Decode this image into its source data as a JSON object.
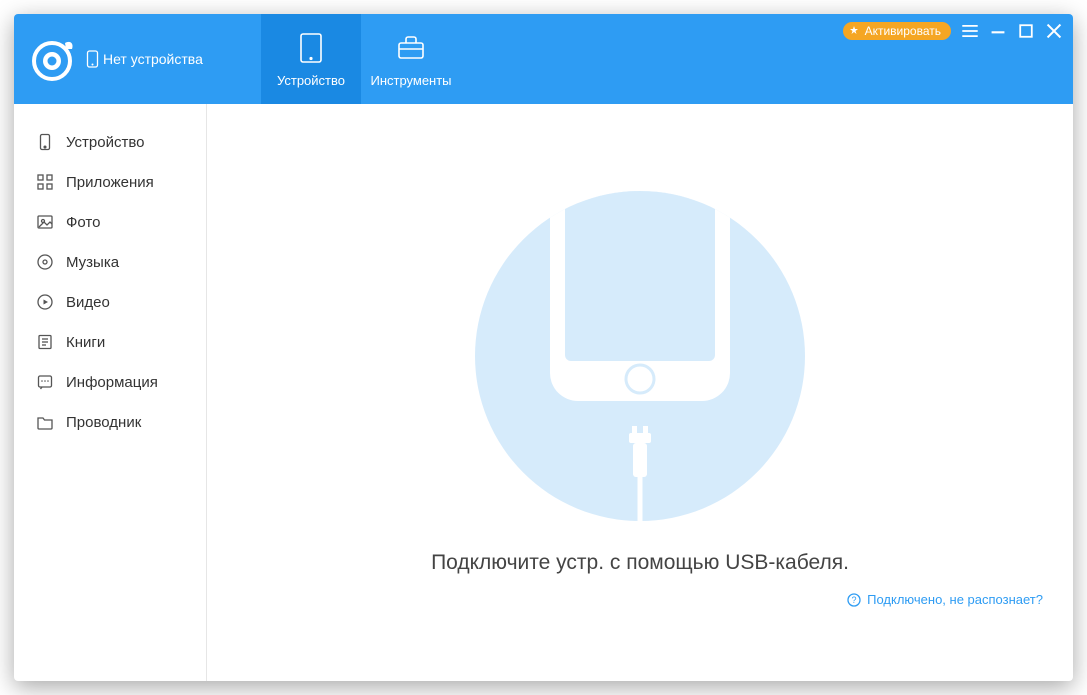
{
  "header": {
    "device_status": "Нет устройства",
    "tabs": {
      "device": "Устройство",
      "tools": "Инструменты"
    },
    "activate": "Активировать"
  },
  "sidebar": {
    "device": "Устройство",
    "apps": "Приложения",
    "photos": "Фото",
    "music": "Музыка",
    "video": "Видео",
    "books": "Книги",
    "info": "Информация",
    "explorer": "Проводник"
  },
  "main": {
    "prompt": "Подключите устр. с помощью USB-кабеля.",
    "help": "Подключено, не распознает?"
  }
}
